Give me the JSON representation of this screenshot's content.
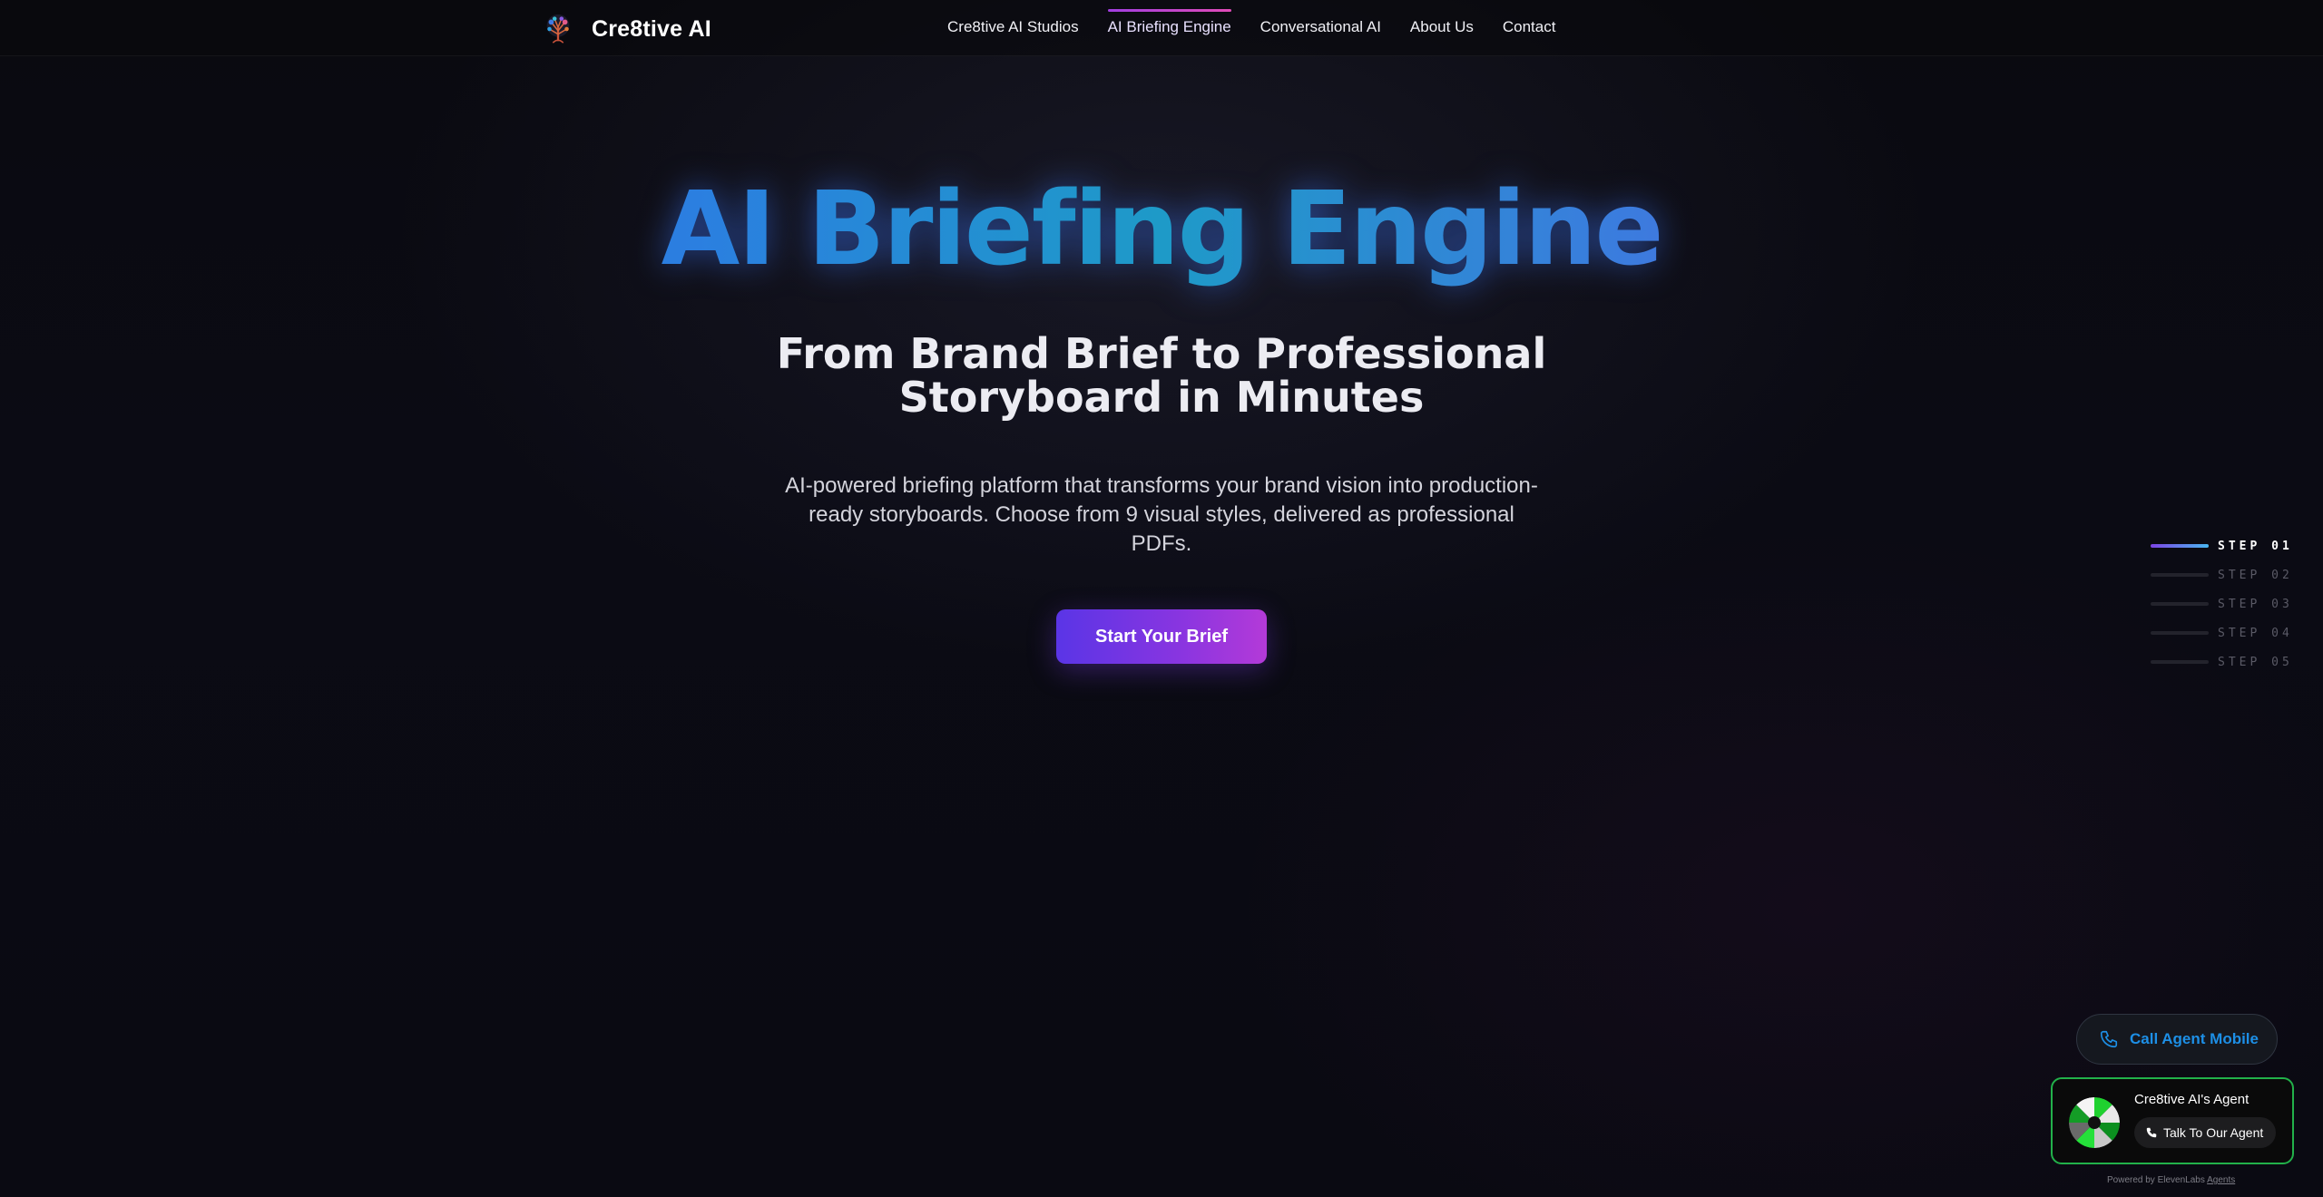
{
  "nav": {
    "brand": "Cre8tive AI",
    "links": [
      {
        "label": "Cre8tive AI Studios",
        "active": false
      },
      {
        "label": "AI Briefing Engine",
        "active": true
      },
      {
        "label": "Conversational AI",
        "active": false
      },
      {
        "label": "About Us",
        "active": false
      },
      {
        "label": "Contact",
        "active": false
      }
    ]
  },
  "hero": {
    "title": "AI Briefing Engine",
    "subtitle": "From Brand Brief to Professional Storyboard in Minutes",
    "description": "AI-powered briefing platform that transforms your brand vision into production-ready storyboards. Choose from 9 visual styles, delivered as professional PDFs.",
    "cta_label": "Start Your Brief"
  },
  "steps": [
    {
      "label": "STEP 01",
      "active": true
    },
    {
      "label": "STEP 02",
      "active": false
    },
    {
      "label": "STEP 03",
      "active": false
    },
    {
      "label": "STEP 04",
      "active": false
    },
    {
      "label": "STEP 05",
      "active": false
    }
  ],
  "call_mobile": {
    "label": "Call Agent Mobile",
    "icon": "phone-icon"
  },
  "agent_widget": {
    "name": "Cre8tive AI's Agent",
    "button_label": "Talk To Our Agent",
    "powered_by": "Powered by ElevenLabs",
    "powered_link": "Agents"
  },
  "colors": {
    "accent_purple": "#7a3ee6",
    "accent_blue": "#2f63e6",
    "agent_border": "#22b14a",
    "call_text": "#1d8fe6"
  }
}
